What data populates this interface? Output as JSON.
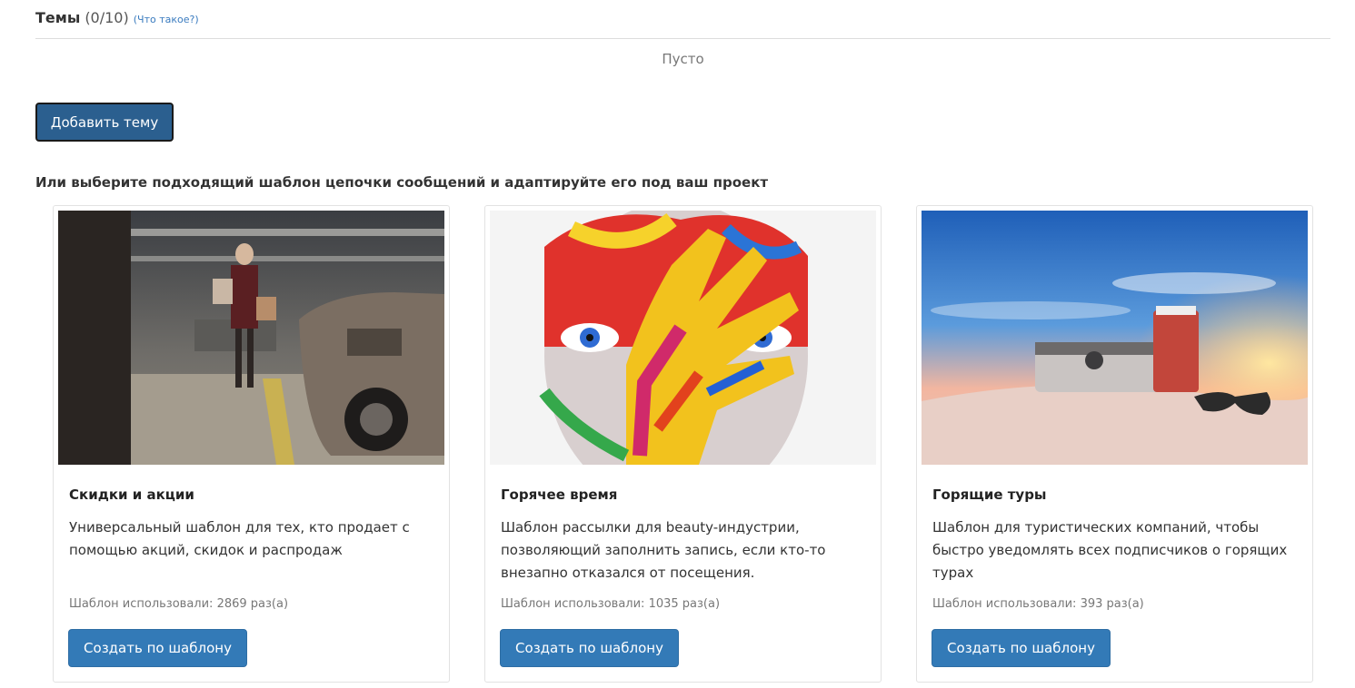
{
  "topics": {
    "title": "Темы",
    "count": "(0/10)",
    "help_link": "(Что такое?)",
    "empty_text": "Пусто",
    "add_button": "Добавить тему"
  },
  "templates": {
    "heading": "Или выберите подходящий шаблон цепочки сообщений и адаптируйте его под ваш проект",
    "cards": [
      {
        "title": "Скидки и акции",
        "description": "Универсальный шаблон для тех, кто продает с помощью акций, скидок и распродаж",
        "usage": "Шаблон использовали: 2869 раз(а)",
        "button": "Создать по шаблону",
        "image": "shopping-woman-parking-photo"
      },
      {
        "title": "Горячее время",
        "description": "Шаблон рассылки для beauty-индустрии, позволяющий заполнить запись, если кто-то внезапно отказался от посещения.",
        "usage": "Шаблон использовали: 1035 раз(а)",
        "button": "Создать по шаблону",
        "image": "painted-face-hand-photo"
      },
      {
        "title": "Горящие туры",
        "description": "Шаблон для туристических компаний, чтобы быстро уведомлять всех подписчиков о горящих турах",
        "usage": "Шаблон использовали: 393 раз(а)",
        "button": "Создать по шаблону",
        "image": "beach-camera-sunglasses-photo"
      }
    ]
  },
  "colors": {
    "primary_button": "#337ab7",
    "add_button": "#2b5f8f",
    "link": "#3a7bbf"
  }
}
